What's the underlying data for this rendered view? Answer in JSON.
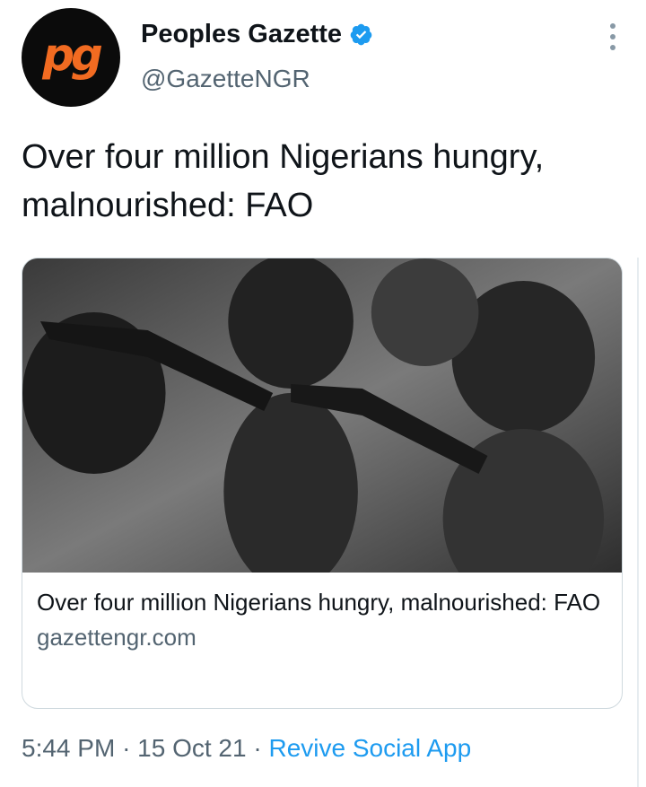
{
  "account": {
    "avatar_text": "pg",
    "display_name": "Peoples Gazette",
    "handle": "@GazetteNGR",
    "verified": true
  },
  "tweet": {
    "text": "Over four million Nigerians hungry, malnourished: FAO"
  },
  "card": {
    "image_description_icon": "photo",
    "title": "Over four million Nigerians hungry, malnourished: FAO",
    "domain": "gazettengr.com"
  },
  "meta": {
    "time": "5:44 PM",
    "separator": "·",
    "date": "15 Oct 21",
    "source": "Revive Social App"
  },
  "colors": {
    "accent": "#1d9bf0",
    "brand_orange": "#f26b21",
    "muted": "#536471"
  }
}
